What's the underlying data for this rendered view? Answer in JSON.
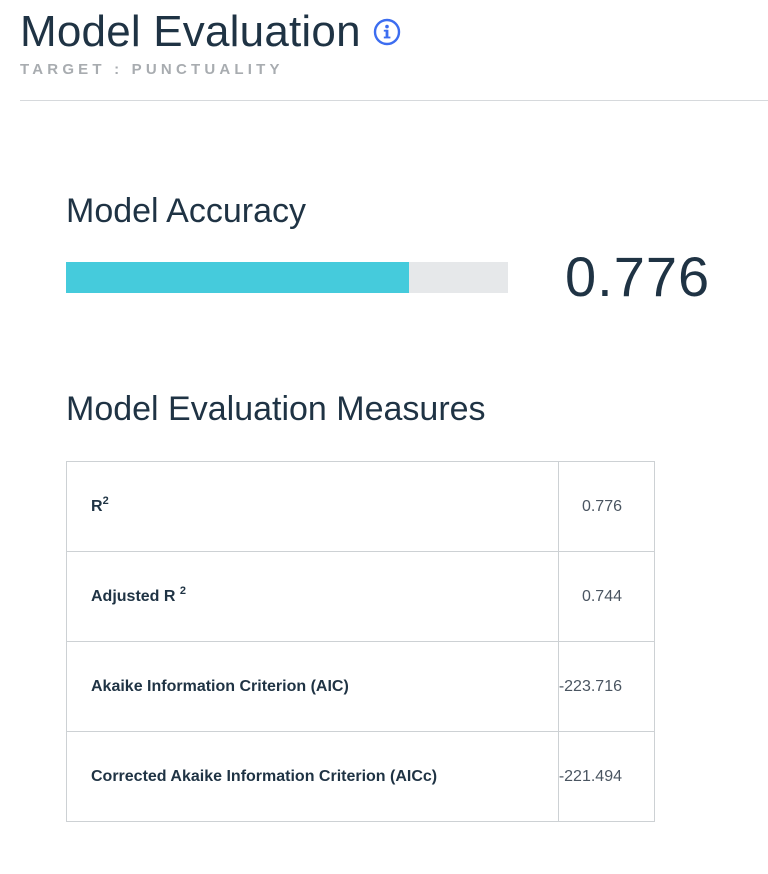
{
  "header": {
    "title": "Model Evaluation",
    "info_icon": "info-icon",
    "subtitle": "TARGET : PUNCTUALITY"
  },
  "accuracy": {
    "title": "Model Accuracy",
    "value": 0.776,
    "value_text": "0.776",
    "bar_color": "#45cbdc",
    "track_color": "#e6e8ea"
  },
  "measures": {
    "title": "Model Evaluation Measures",
    "rows": [
      {
        "label": "R",
        "sup": "2",
        "value": "0.776"
      },
      {
        "label": "Adjusted R",
        "sup": "2",
        "value": "0.744"
      },
      {
        "label": "Akaike Information Criterion (AIC)",
        "sup": "",
        "value": "-223.716"
      },
      {
        "label": "Corrected Akaike Information Criterion (AICc)",
        "sup": "",
        "value": "-221.494"
      }
    ]
  },
  "colors": {
    "heading": "#1f3344",
    "subtitle": "#a8acb0",
    "info_icon": "#3c6df0"
  }
}
